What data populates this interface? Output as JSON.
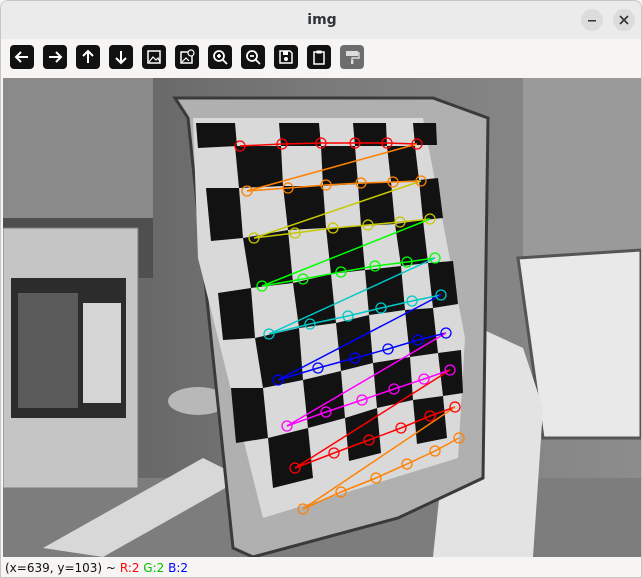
{
  "window": {
    "title": "img"
  },
  "toolbar": {
    "buttons": [
      {
        "name": "pan-left",
        "icon": "arrow-left-icon"
      },
      {
        "name": "pan-right",
        "icon": "arrow-right-icon"
      },
      {
        "name": "pan-up",
        "icon": "arrow-up-icon"
      },
      {
        "name": "pan-down",
        "icon": "arrow-down-icon"
      },
      {
        "name": "zoom-to-fit",
        "icon": "image-icon"
      },
      {
        "name": "zoom-original",
        "icon": "image-zoom-icon"
      },
      {
        "name": "zoom-in",
        "icon": "zoom-in-icon"
      },
      {
        "name": "zoom-out",
        "icon": "zoom-out-icon"
      },
      {
        "name": "save",
        "icon": "save-icon"
      },
      {
        "name": "copy-to-clipboard",
        "icon": "clipboard-icon"
      },
      {
        "name": "properties",
        "icon": "paint-roller-icon",
        "disabled": true
      }
    ]
  },
  "status": {
    "coords": "(x=639, y=103) ~",
    "r_label": "R:2",
    "g_label": "G:2",
    "b_label": "B:2",
    "r_color": "#ff0000",
    "g_color": "#00c000",
    "b_color": "#0000ff"
  },
  "image": {
    "description_colors": {
      "row1": "#ff0000",
      "row2": "#ff8000",
      "row3": "#c8c800",
      "row4": "#00ff00",
      "row5": "#00c8c8",
      "row6": "#0000ff",
      "row7": "#ff00ff",
      "row8": "#ff0000",
      "row9": "#ff8000"
    }
  }
}
